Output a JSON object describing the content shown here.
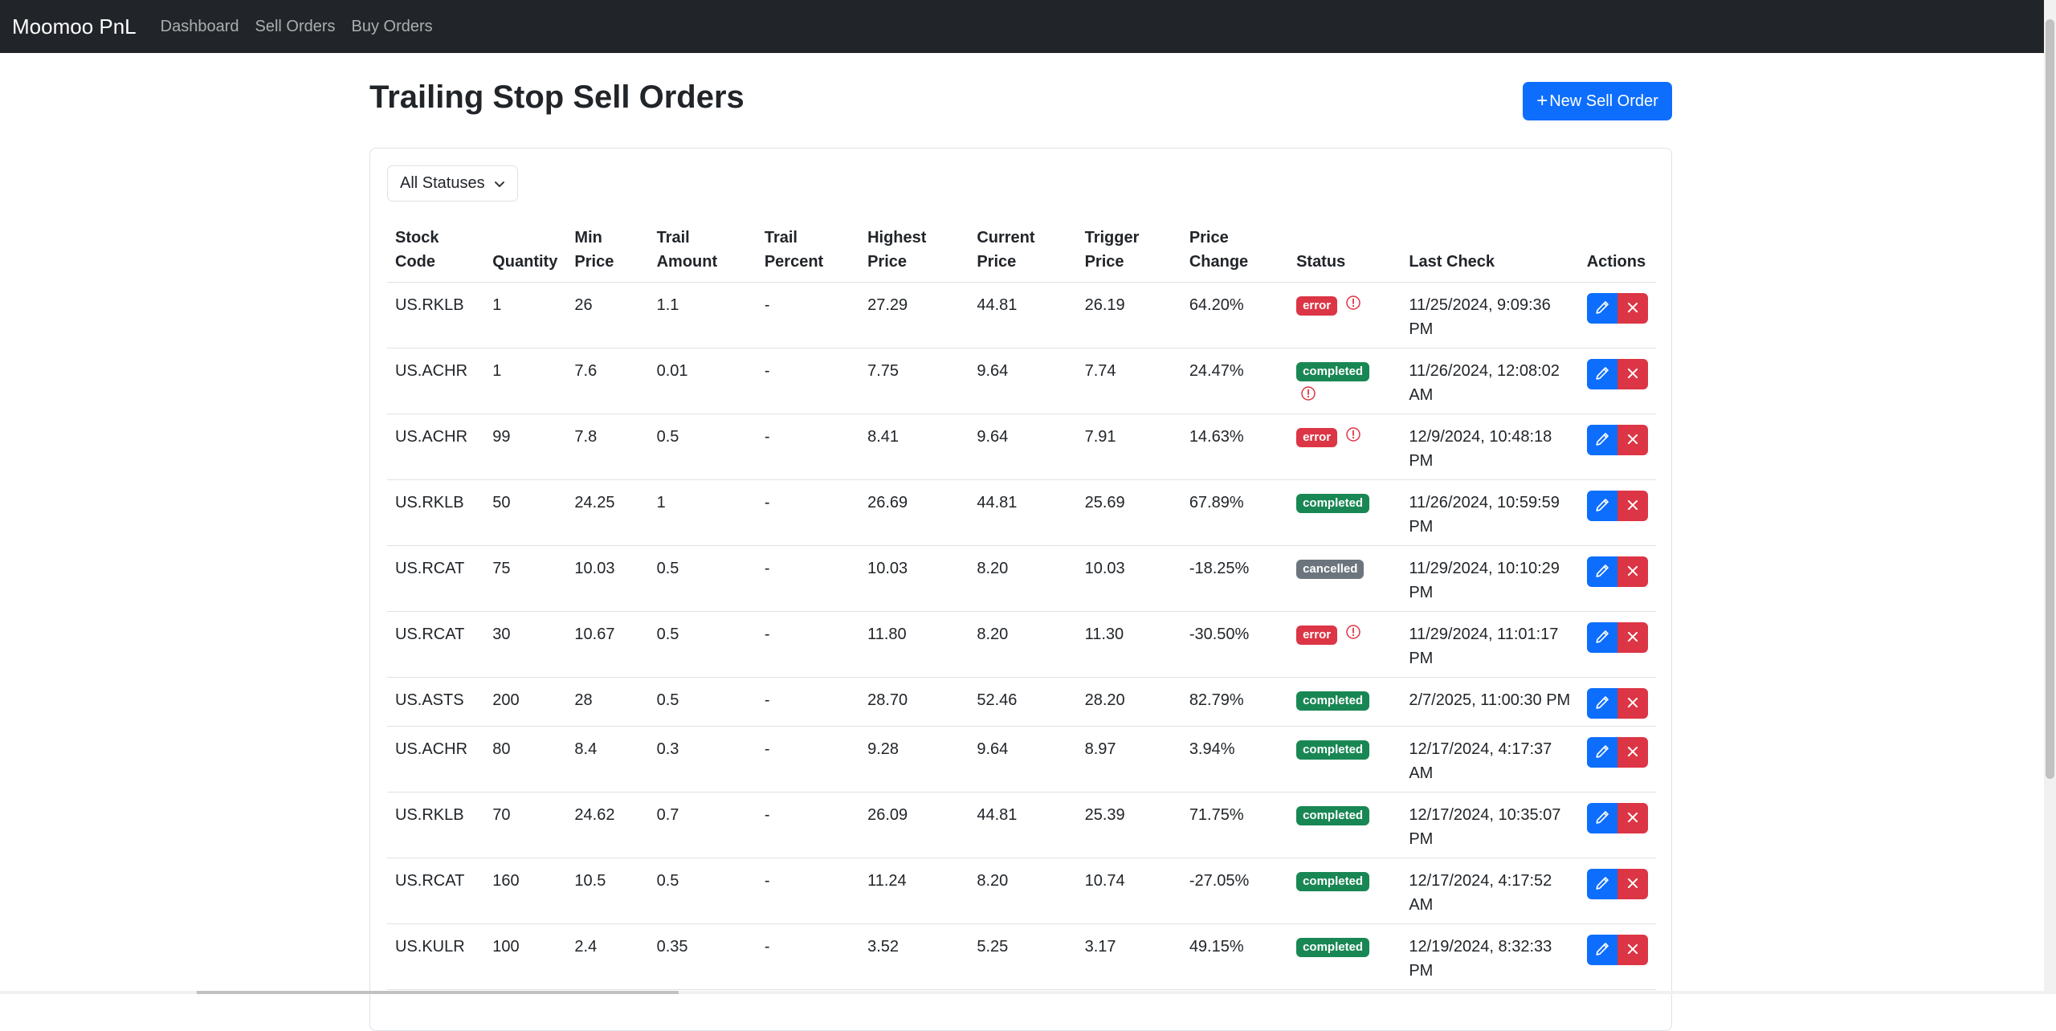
{
  "nav": {
    "brand": "Moomoo PnL",
    "links": [
      "Dashboard",
      "Sell Orders",
      "Buy Orders"
    ]
  },
  "page": {
    "title": "Trailing Stop Sell Orders",
    "new_button": "New Sell Order"
  },
  "filter": {
    "selected": "All Statuses"
  },
  "table": {
    "headers": {
      "stock_code": [
        "Stock",
        "Code"
      ],
      "quantity": "Quantity",
      "min_price": [
        "Min",
        "Price"
      ],
      "trail_amount": [
        "Trail",
        "Amount"
      ],
      "trail_percent": [
        "Trail",
        "Percent"
      ],
      "highest_price": [
        "Highest",
        "Price"
      ],
      "current_price": [
        "Current",
        "Price"
      ],
      "trigger_price": [
        "Trigger",
        "Price"
      ],
      "price_change": [
        "Price",
        "Change"
      ],
      "status": "Status",
      "last_check": "Last Check",
      "actions": "Actions"
    },
    "rows": [
      {
        "stock_code": "US.RKLB",
        "quantity": "1",
        "min_price": "26",
        "trail_amount": "1.1",
        "trail_percent": "-",
        "highest_price": "27.29",
        "current_price": "44.81",
        "trigger_price": "26.19",
        "price_change": "64.20%",
        "status": "error",
        "warning": true,
        "last_check": [
          "11/25/2024, 9:09:36",
          "PM"
        ]
      },
      {
        "stock_code": "US.ACHR",
        "quantity": "1",
        "min_price": "7.6",
        "trail_amount": "0.01",
        "trail_percent": "-",
        "highest_price": "7.75",
        "current_price": "9.64",
        "trigger_price": "7.74",
        "price_change": "24.47%",
        "status": "completed",
        "warning": true,
        "last_check": [
          "11/26/2024, 12:08:02",
          "AM"
        ]
      },
      {
        "stock_code": "US.ACHR",
        "quantity": "99",
        "min_price": "7.8",
        "trail_amount": "0.5",
        "trail_percent": "-",
        "highest_price": "8.41",
        "current_price": "9.64",
        "trigger_price": "7.91",
        "price_change": "14.63%",
        "status": "error",
        "warning": true,
        "last_check": [
          "12/9/2024, 10:48:18",
          "PM"
        ]
      },
      {
        "stock_code": "US.RKLB",
        "quantity": "50",
        "min_price": "24.25",
        "trail_amount": "1",
        "trail_percent": "-",
        "highest_price": "26.69",
        "current_price": "44.81",
        "trigger_price": "25.69",
        "price_change": "67.89%",
        "status": "completed",
        "warning": false,
        "last_check": [
          "11/26/2024, 10:59:59",
          "PM"
        ]
      },
      {
        "stock_code": "US.RCAT",
        "quantity": "75",
        "min_price": "10.03",
        "trail_amount": "0.5",
        "trail_percent": "-",
        "highest_price": "10.03",
        "current_price": "8.20",
        "trigger_price": "10.03",
        "price_change": "-18.25%",
        "status": "cancelled",
        "warning": false,
        "last_check": [
          "11/29/2024, 10:10:29",
          "PM"
        ]
      },
      {
        "stock_code": "US.RCAT",
        "quantity": "30",
        "min_price": "10.67",
        "trail_amount": "0.5",
        "trail_percent": "-",
        "highest_price": "11.80",
        "current_price": "8.20",
        "trigger_price": "11.30",
        "price_change": "-30.50%",
        "status": "error",
        "warning": true,
        "last_check": [
          "11/29/2024, 11:01:17",
          "PM"
        ]
      },
      {
        "stock_code": "US.ASTS",
        "quantity": "200",
        "min_price": "28",
        "trail_amount": "0.5",
        "trail_percent": "-",
        "highest_price": "28.70",
        "current_price": "52.46",
        "trigger_price": "28.20",
        "price_change": "82.79%",
        "status": "completed",
        "warning": false,
        "last_check": [
          "2/7/2025, 11:00:30 PM"
        ]
      },
      {
        "stock_code": "US.ACHR",
        "quantity": "80",
        "min_price": "8.4",
        "trail_amount": "0.3",
        "trail_percent": "-",
        "highest_price": "9.28",
        "current_price": "9.64",
        "trigger_price": "8.97",
        "price_change": "3.94%",
        "status": "completed",
        "warning": false,
        "last_check": [
          "12/17/2024, 4:17:37",
          "AM"
        ]
      },
      {
        "stock_code": "US.RKLB",
        "quantity": "70",
        "min_price": "24.62",
        "trail_amount": "0.7",
        "trail_percent": "-",
        "highest_price": "26.09",
        "current_price": "44.81",
        "trigger_price": "25.39",
        "price_change": "71.75%",
        "status": "completed",
        "warning": false,
        "last_check": [
          "12/17/2024, 10:35:07",
          "PM"
        ]
      },
      {
        "stock_code": "US.RCAT",
        "quantity": "160",
        "min_price": "10.5",
        "trail_amount": "0.5",
        "trail_percent": "-",
        "highest_price": "11.24",
        "current_price": "8.20",
        "trigger_price": "10.74",
        "price_change": "-27.05%",
        "status": "completed",
        "warning": false,
        "last_check": [
          "12/17/2024, 4:17:52",
          "AM"
        ]
      },
      {
        "stock_code": "US.KULR",
        "quantity": "100",
        "min_price": "2.4",
        "trail_amount": "0.35",
        "trail_percent": "-",
        "highest_price": "3.52",
        "current_price": "5.25",
        "trigger_price": "3.17",
        "price_change": "49.15%",
        "status": "completed",
        "warning": false,
        "last_check": [
          "12/19/2024, 8:32:33",
          "PM"
        ]
      }
    ]
  },
  "colors": {
    "navbar": "#212529",
    "primary": "#0d6efd",
    "danger": "#dc3545",
    "success": "#198754",
    "secondary": "#6c757d"
  },
  "icons": {
    "warning": "exclamation-circle-icon",
    "edit": "pencil-icon",
    "delete": "x-icon",
    "add": "plus-icon",
    "dropdown": "chevron-down-icon"
  }
}
